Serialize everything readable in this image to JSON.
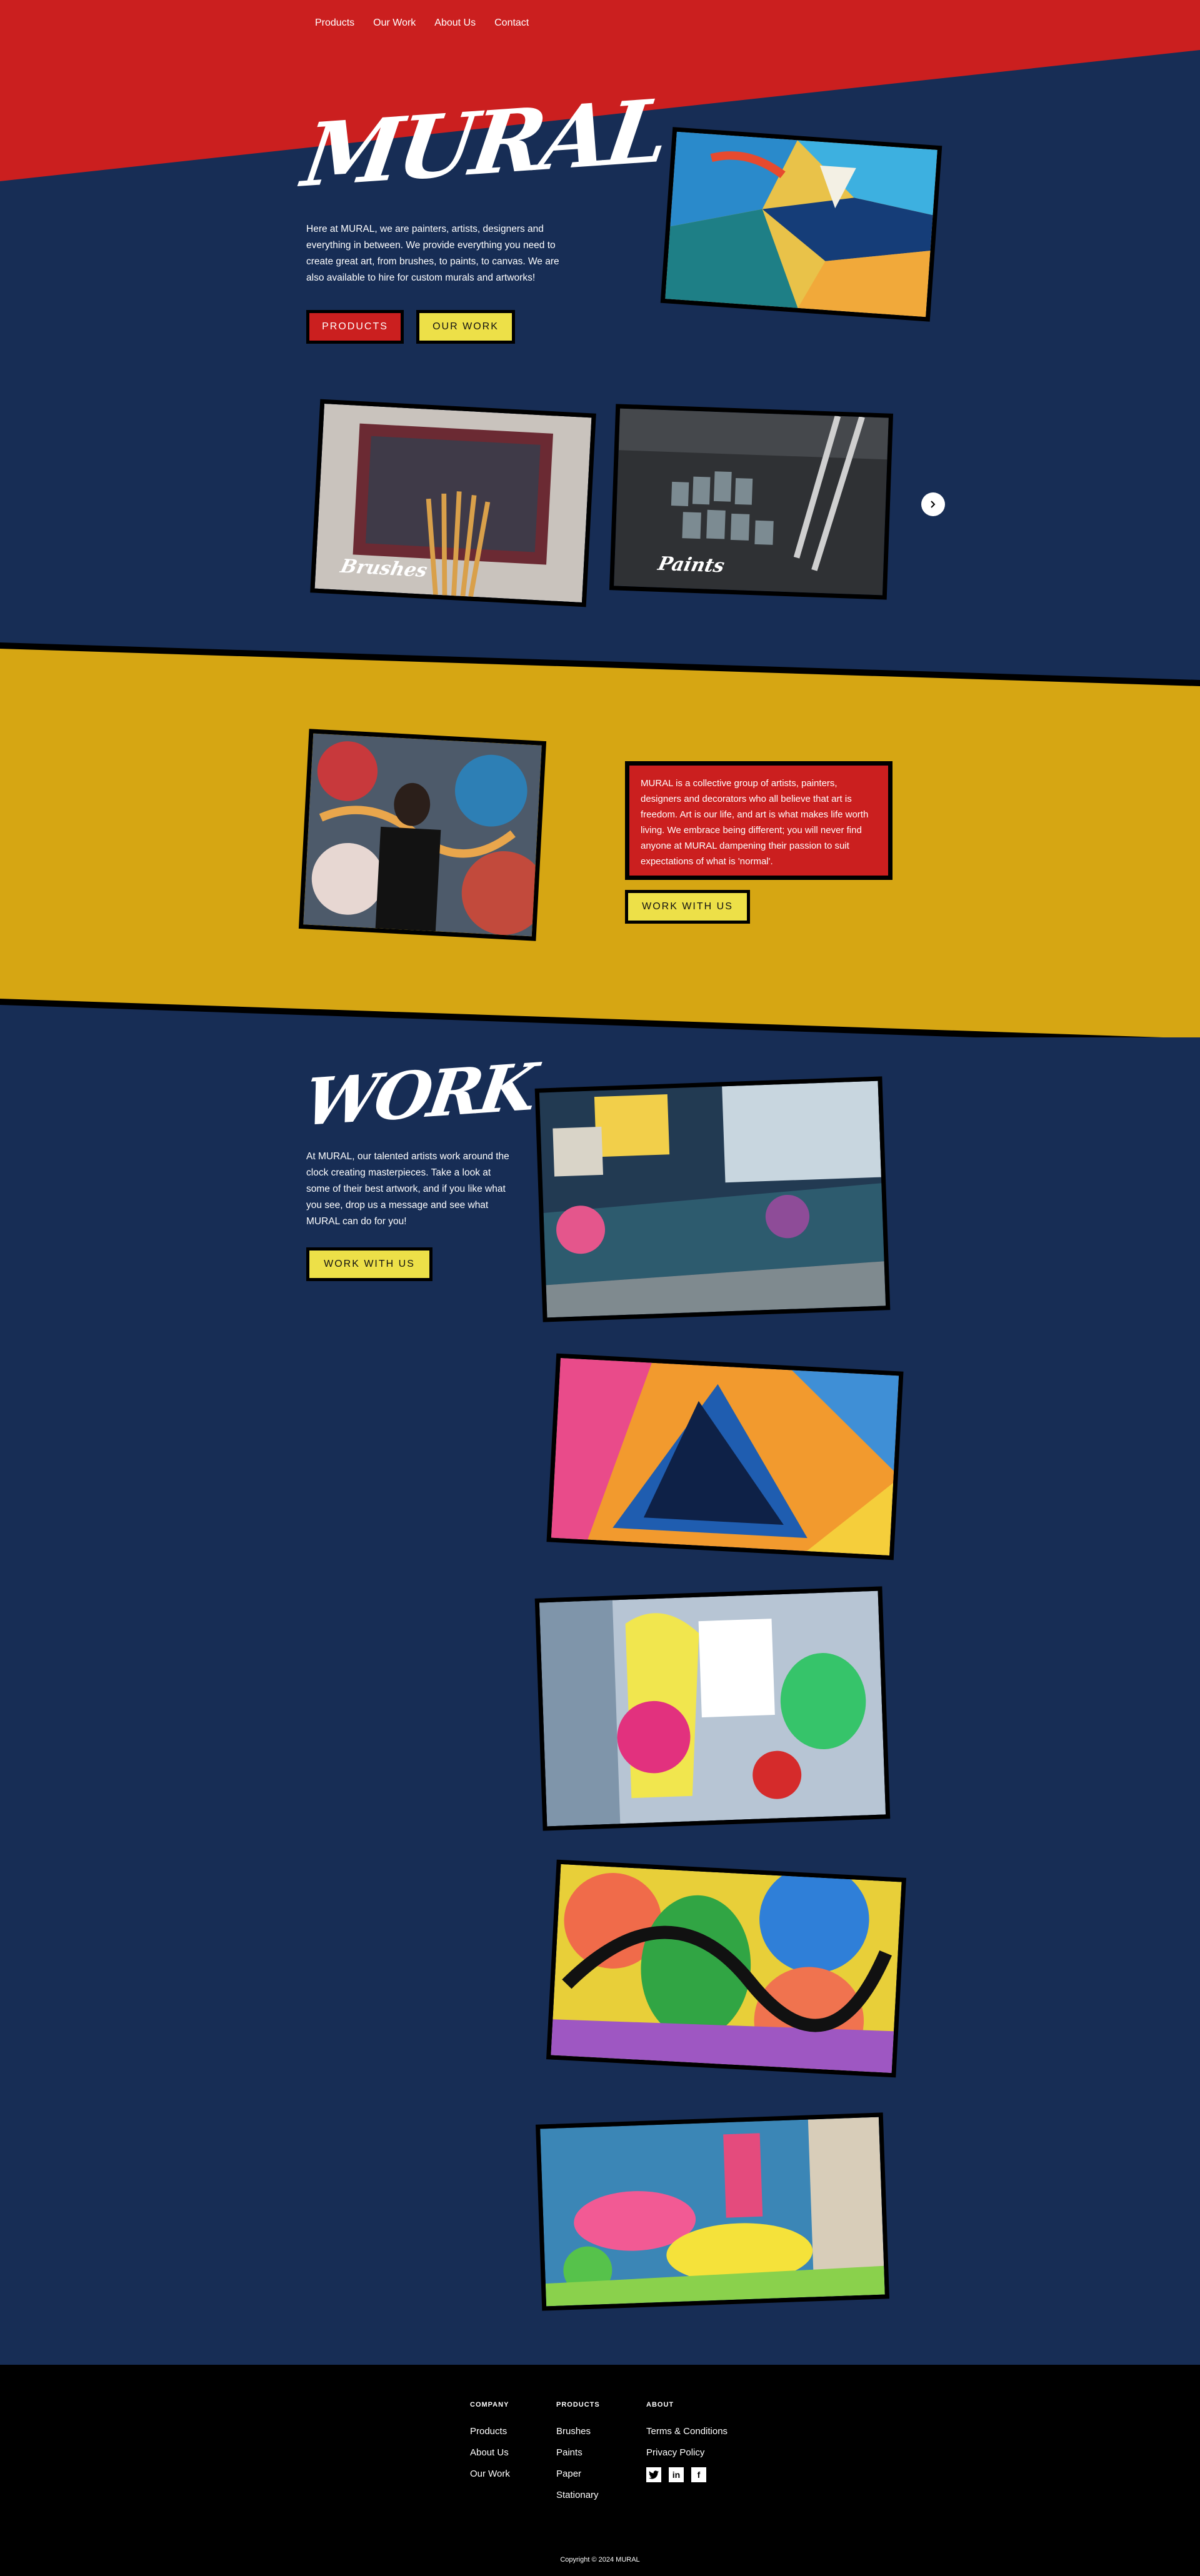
{
  "nav": [
    "Products",
    "Our Work",
    "About Us",
    "Contact"
  ],
  "hero": {
    "logo": "MURAL",
    "text": "Here at MURAL, we are painters, artists, designers and everything in between. We provide everything you need to create great art, from brushes, to paints, to canvas. We are also available to hire for custom murals and artworks!",
    "btn_products": "PRODUCTS",
    "btn_work": "OUR WORK"
  },
  "carousel": {
    "items": [
      {
        "label": "Brushes"
      },
      {
        "label": "Paints"
      }
    ],
    "next_icon": "chevron-right-icon"
  },
  "about": {
    "text": "MURAL is a collective group of artists, painters, designers and decorators who all believe that art is freedom. Art is our life, and art is what makes life worth living. We embrace being different; you will never find anyone at MURAL dampening their passion to suit expectations of what is 'normal'.",
    "button": "WORK WITH US"
  },
  "work": {
    "heading": "WORK",
    "text": "At MURAL, our talented artists work around the clock creating masterpieces. Take a look at some of their best artwork, and if you like what you see, drop us a message and see what MURAL can do for you!",
    "button": "WORK WITH US"
  },
  "footer": {
    "company": {
      "title": "COMPANY",
      "links": [
        "Products",
        "About Us",
        "Our Work"
      ]
    },
    "products": {
      "title": "PRODUCTS",
      "links": [
        "Brushes",
        "Paints",
        "Paper",
        "Stationary"
      ]
    },
    "about": {
      "title": "ABOUT",
      "links": [
        "Terms & Conditions",
        "Privacy Policy"
      ]
    },
    "social_icons": [
      "twitter-icon",
      "linkedin-icon",
      "facebook-icon"
    ],
    "copyright": "Copyright © 2024 MURAL"
  },
  "colors": {
    "navy": "#172d55",
    "red": "#cb1f1f",
    "yellow_band": "#d6a613",
    "yellow_button": "#ede048",
    "black": "#000000"
  }
}
